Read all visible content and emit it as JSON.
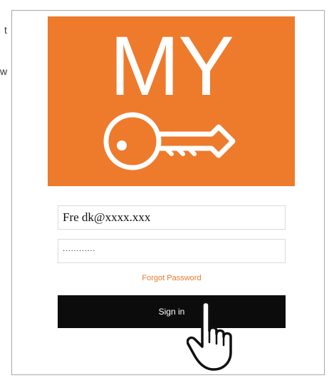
{
  "background": {
    "fragment_1": "t",
    "fragment_2": "w"
  },
  "logo": {
    "text": "MY",
    "icon": "key-icon",
    "color": "#ee7a2b"
  },
  "login": {
    "email_value": "Fre dk@xxxx.xxx",
    "password_value": "············",
    "forgot_label": "Forgot Password",
    "signin_label": "Sign in"
  },
  "pointer": {
    "icon": "hand-pointer-icon"
  }
}
